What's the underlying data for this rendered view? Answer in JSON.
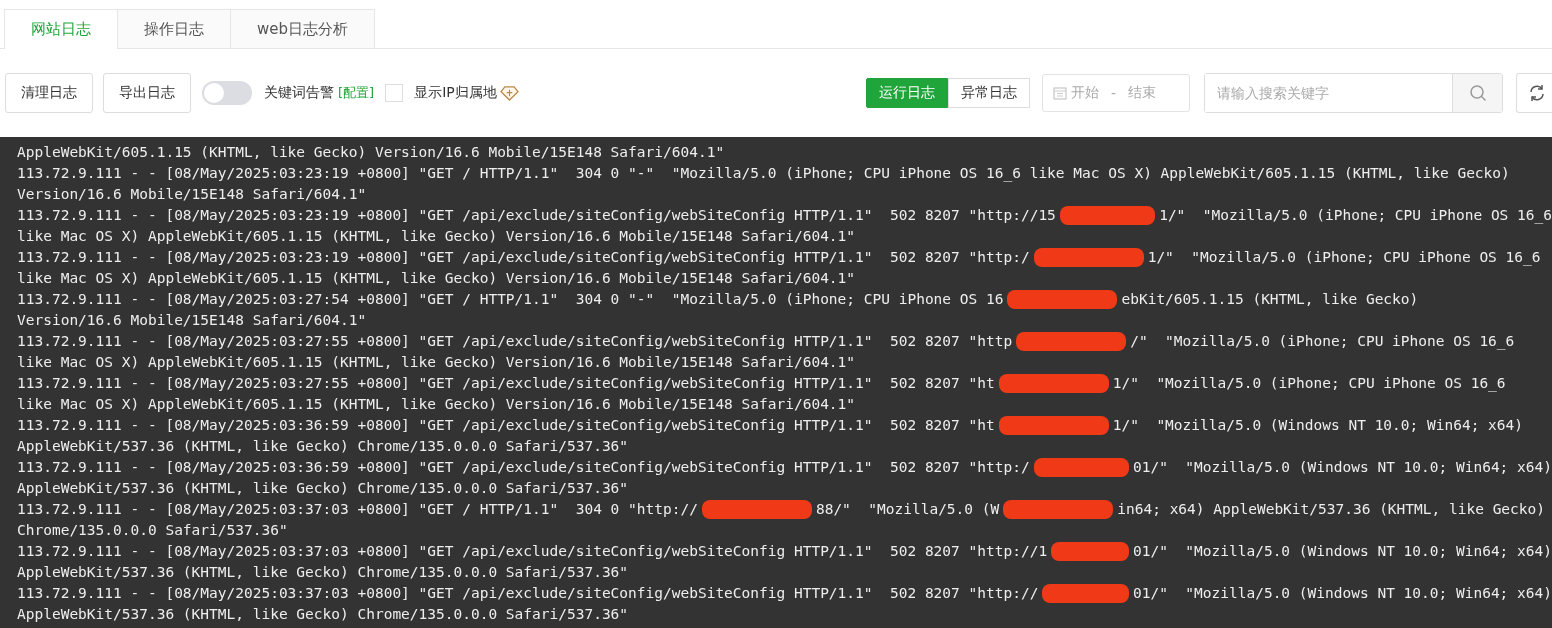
{
  "tabs": [
    {
      "label": "网站日志",
      "selected": true
    },
    {
      "label": "操作日志",
      "selected": false
    },
    {
      "label": "web日志分析",
      "selected": false
    }
  ],
  "toolbar": {
    "buttons": [
      "清理日志",
      "导出日志"
    ],
    "keyword_alert": {
      "on": false,
      "label": "关键词告警",
      "link": "[配置]"
    },
    "show_ip_location": {
      "checked": false,
      "label": "显示IP归属地"
    },
    "log_types": [
      {
        "label": "运行日志",
        "selected": true
      },
      {
        "label": "异常日志",
        "selected": false
      }
    ],
    "date_range": {
      "start_placeholder": "开始",
      "separator": "-",
      "end_placeholder": "结束"
    },
    "search": {
      "placeholder": "请输入搜索关键字"
    }
  },
  "log_lines": [
    {
      "parts": [
        "AppleWebKit/605.1.15 (KHTML, like Gecko) Version/16.6 Mobile/15E148 Safari/604.1\""
      ]
    },
    {
      "parts": [
        "113.72.9.111 - - [08/May/2025:03:23:19 +0800] \"GET / HTTP/1.1\"  304 0 \"-\"  \"Mozilla/5.0 (iPhone; CPU iPhone OS 16_6 like Mac OS X) AppleWebKit/605.1.15 (KHTML, like Gecko)"
      ]
    },
    {
      "parts": [
        "Version/16.6 Mobile/15E148 Safari/604.1\""
      ]
    },
    {
      "parts": [
        "113.72.9.111 - - [08/May/2025:03:23:19 +0800] \"GET /api/exclude/siteConfig/webSiteConfig HTTP/1.1\"  502 8207 \"http://15",
        "1/\"  \"Mozilla/5.0 (iPhone; CPU iPhone OS 16_6"
      ]
    },
    {
      "parts": [
        "like Mac OS X) AppleWebKit/605.1.15 (KHTML, like Gecko) Version/16.6 Mobile/15E148 Safari/604.1\""
      ]
    },
    {
      "parts": [
        "113.72.9.111 - - [08/May/2025:03:23:19 +0800] \"GET /api/exclude/siteConfig/webSiteConfig HTTP/1.1\"  502 8207 \"http:/",
        "1/\"  \"Mozilla/5.0 (iPhone; CPU iPhone OS 16_6"
      ]
    },
    {
      "parts": [
        "like Mac OS X) AppleWebKit/605.1.15 (KHTML, like Gecko) Version/16.6 Mobile/15E148 Safari/604.1\""
      ]
    },
    {
      "parts": [
        "113.72.9.111 - - [08/May/2025:03:27:54 +0800] \"GET / HTTP/1.1\"  304 0 \"-\"  \"Mozilla/5.0 (iPhone; CPU iPhone OS 16",
        "ebKit/605.1.15 (KHTML, like Gecko)"
      ]
    },
    {
      "parts": [
        "Version/16.6 Mobile/15E148 Safari/604.1\""
      ]
    },
    {
      "parts": [
        "113.72.9.111 - - [08/May/2025:03:27:55 +0800] \"GET /api/exclude/siteConfig/webSiteConfig HTTP/1.1\"  502 8207 \"http",
        "/\"  \"Mozilla/5.0 (iPhone; CPU iPhone OS 16_6"
      ]
    },
    {
      "parts": [
        "like Mac OS X) AppleWebKit/605.1.15 (KHTML, like Gecko) Version/16.6 Mobile/15E148 Safari/604.1\""
      ]
    },
    {
      "parts": [
        "113.72.9.111 - - [08/May/2025:03:27:55 +0800] \"GET /api/exclude/siteConfig/webSiteConfig HTTP/1.1\"  502 8207 \"ht",
        "1/\"  \"Mozilla/5.0 (iPhone; CPU iPhone OS 16_6"
      ]
    },
    {
      "parts": [
        "like Mac OS X) AppleWebKit/605.1.15 (KHTML, like Gecko) Version/16.6 Mobile/15E148 Safari/604.1\""
      ]
    },
    {
      "parts": [
        "113.72.9.111 - - [08/May/2025:03:36:59 +0800] \"GET /api/exclude/siteConfig/webSiteConfig HTTP/1.1\"  502 8207 \"ht",
        "1/\"  \"Mozilla/5.0 (Windows NT 10.0; Win64; x64)"
      ]
    },
    {
      "parts": [
        "AppleWebKit/537.36 (KHTML, like Gecko) Chrome/135.0.0.0 Safari/537.36\""
      ]
    },
    {
      "parts": [
        "113.72.9.111 - - [08/May/2025:03:36:59 +0800] \"GET /api/exclude/siteConfig/webSiteConfig HTTP/1.1\"  502 8207 \"http:/",
        "01/\"  \"Mozilla/5.0 (Windows NT 10.0; Win64; x64)"
      ]
    },
    {
      "parts": [
        "AppleWebKit/537.36 (KHTML, like Gecko) Chrome/135.0.0.0 Safari/537.36\""
      ]
    },
    {
      "parts": [
        "113.72.9.111 - - [08/May/2025:03:37:03 +0800] \"GET / HTTP/1.1\"  304 0 \"http://",
        "88/\"  \"Mozilla/5.0 (W",
        "in64; x64) AppleWebKit/537.36 (KHTML, like Gecko)"
      ]
    },
    {
      "parts": [
        "Chrome/135.0.0.0 Safari/537.36\""
      ]
    },
    {
      "parts": [
        "113.72.9.111 - - [08/May/2025:03:37:03 +0800] \"GET /api/exclude/siteConfig/webSiteConfig HTTP/1.1\"  502 8207 \"http://1",
        "01/\"  \"Mozilla/5.0 (Windows NT 10.0; Win64; x64)"
      ]
    },
    {
      "parts": [
        "AppleWebKit/537.36 (KHTML, like Gecko) Chrome/135.0.0.0 Safari/537.36\""
      ]
    },
    {
      "parts": [
        "113.72.9.111 - - [08/May/2025:03:37:03 +0800] \"GET /api/exclude/siteConfig/webSiteConfig HTTP/1.1\"  502 8207 \"http://",
        "01/\"  \"Mozilla/5.0 (Windows NT 10.0; Win64; x64)"
      ]
    },
    {
      "parts": [
        "AppleWebKit/537.36 (KHTML, like Gecko) Chrome/135.0.0.0 Safari/537.36\""
      ]
    }
  ]
}
